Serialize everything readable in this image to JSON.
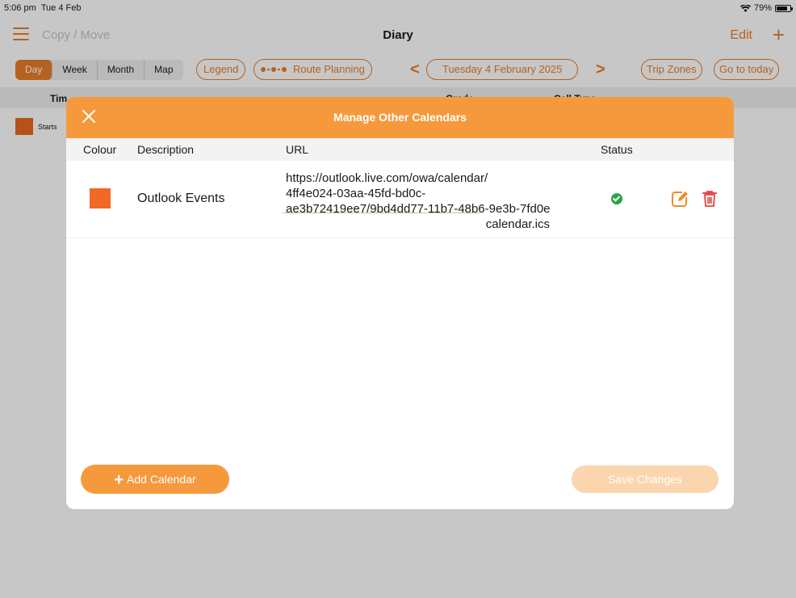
{
  "status_bar": {
    "time": "5:06 pm",
    "date": "Tue 4 Feb",
    "battery": "79%",
    "battery_level": 0.79
  },
  "nav": {
    "copy_move": "Copy / Move",
    "title": "Diary",
    "edit": "Edit",
    "add": "+"
  },
  "toolbar": {
    "views": [
      "Day",
      "Week",
      "Month",
      "Map"
    ],
    "active_view": "Day",
    "legend": "Legend",
    "route_planning": "Route Planning",
    "prev": "<",
    "date": "Tuesday 4 February 2025",
    "next": ">",
    "trip_zones": "Trip Zones",
    "go_to_today": "Go to today"
  },
  "grid_header": {
    "col1": "Tim",
    "col2": "Grade",
    "col3": "Call Type"
  },
  "background_event": {
    "label": "Starts",
    "color": "#e8691f"
  },
  "modal": {
    "title": "Manage Other Calendars",
    "columns": {
      "colour": "Colour",
      "description": "Description",
      "url": "URL",
      "status": "Status"
    },
    "rows": [
      {
        "color": "#f06a25",
        "description": "Outlook Events",
        "url_lines": [
          "https://outlook.live.com/owa/calendar/",
          "4ff4e024-03aa-45fd-bd0c-",
          "ae3b72419ee7/9bd4dd77-11b7-48b6-9e3b-7fd0e",
          "calendar.ics"
        ],
        "status_icon": "check-circle-icon",
        "status_color": "#2aa44a"
      }
    ],
    "add_button": "Add Calendar",
    "save_button": "Save Changes"
  },
  "colors": {
    "accent": "#e87e2a",
    "header": "#f6993c",
    "disabled": "#fbd5ae",
    "delete": "#e8423f"
  }
}
